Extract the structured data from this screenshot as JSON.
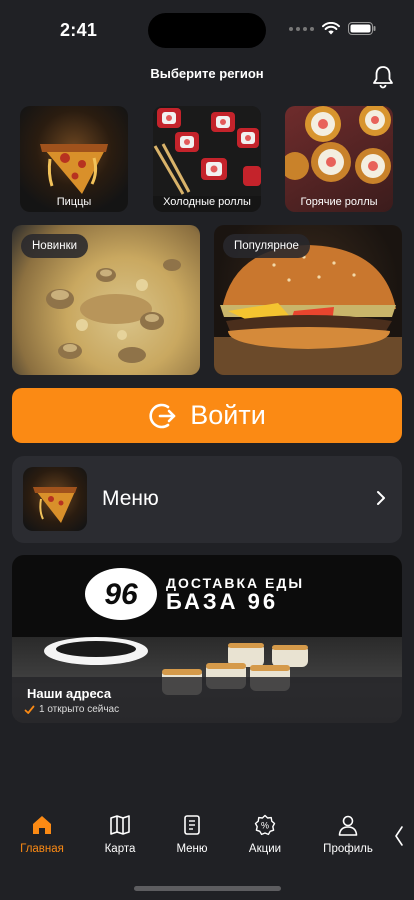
{
  "status_bar": {
    "time": "2:41"
  },
  "header": {
    "title": "Выберите регион"
  },
  "categories": [
    {
      "label": "Пиццы"
    },
    {
      "label": "Холодные роллы"
    },
    {
      "label": "Горячие роллы"
    }
  ],
  "featured": [
    {
      "label": "Новинки"
    },
    {
      "label": "Популярное"
    }
  ],
  "login_button": {
    "label": "Войти"
  },
  "menu_card": {
    "label": "Меню"
  },
  "address_card": {
    "brand_line1": "ДОСТАВКА ЕДЫ",
    "brand_line2": "БАЗА 96",
    "logo_text": "96",
    "title": "Наши адреса",
    "status": "1 открыто сейчас"
  },
  "tabs": [
    {
      "label": "Главная",
      "icon": "home-icon",
      "active": true
    },
    {
      "label": "Карта",
      "icon": "map-icon"
    },
    {
      "label": "Меню",
      "icon": "menu-book-icon"
    },
    {
      "label": "Акции",
      "icon": "discount-icon"
    },
    {
      "label": "Профиль",
      "icon": "profile-icon"
    }
  ],
  "colors": {
    "accent": "#fb8a14",
    "background": "#202125",
    "card": "#2b2c31"
  }
}
